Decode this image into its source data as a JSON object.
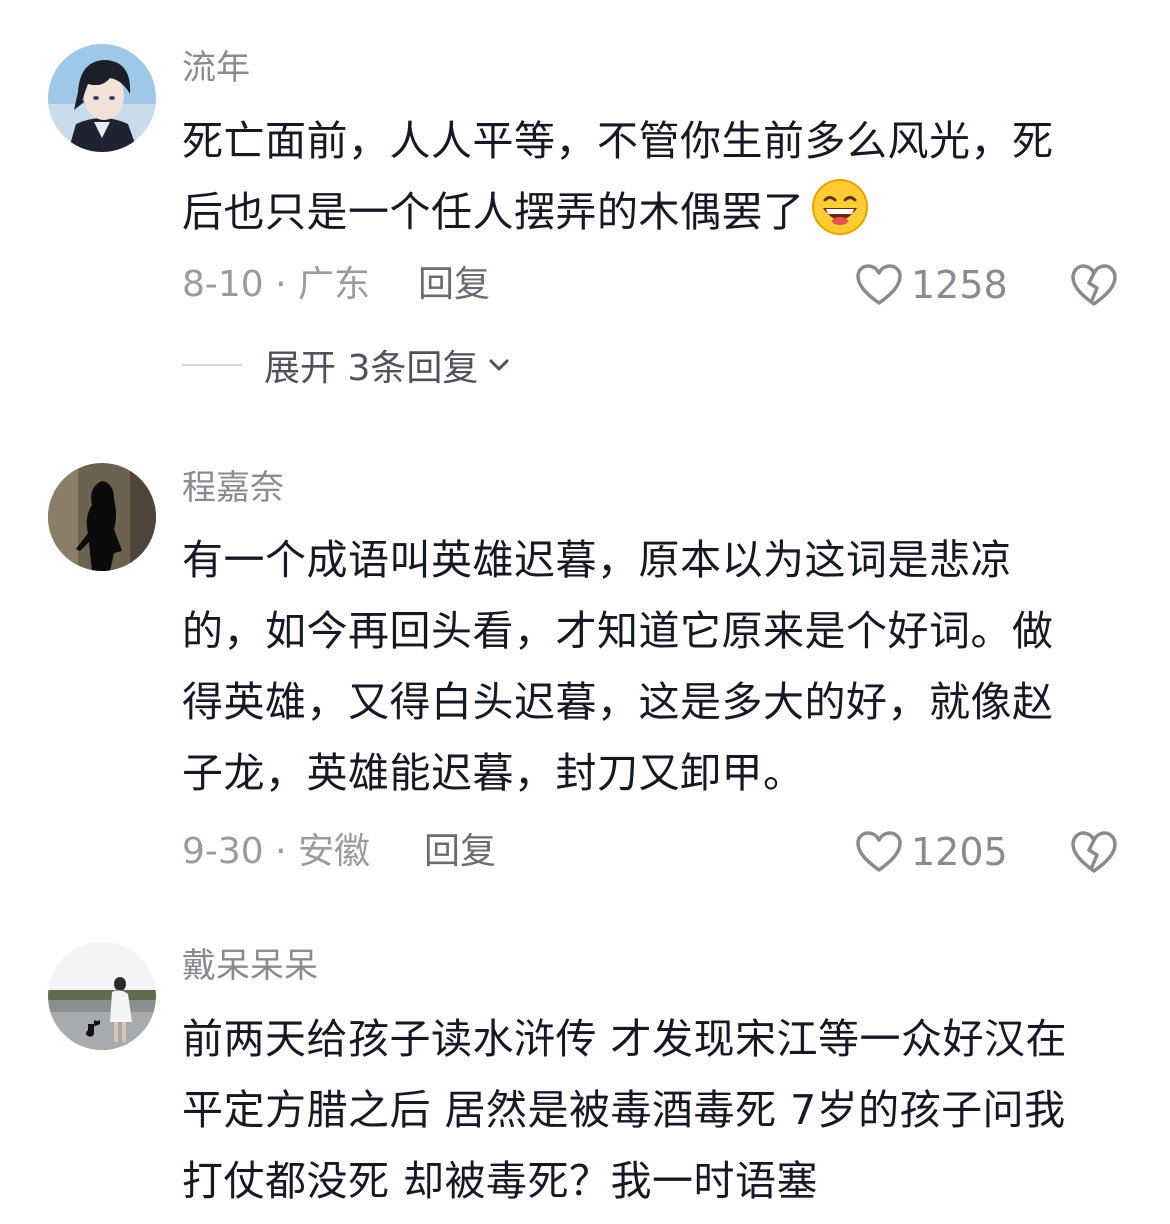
{
  "comments": [
    {
      "username": "流年",
      "lines": [
        "死亡面前，人人平等，不管你生前多么风光，死",
        "后也只是一个任人摆弄的木偶罢了"
      ],
      "emoji": "grinning-squint-emoji",
      "meta": "8-10 · 广东",
      "reply_label": "回复",
      "likes": "1258",
      "expand_label": "展开 3条回复"
    },
    {
      "username": "程嘉奈",
      "lines": [
        "有一个成语叫英雄迟暮，原本以为这词是悲凉",
        "的，如今再回头看，才知道它原来是个好词。做",
        "得英雄，又得白头迟暮，这是多大的好，就像赵",
        "子龙，英雄能迟暮，封刀又卸甲。"
      ],
      "meta": "9-30 · 安徽",
      "reply_label": "回复",
      "likes": "1205"
    },
    {
      "username": "戴呆呆呆",
      "lines": [
        "前两天给孩子读水浒传 才发现宋江等一众好汉在",
        "平定方腊之后 居然是被毒酒毒死 7岁的孩子问我",
        "打仗都没死 却被毒死？我一时语塞"
      ]
    }
  ],
  "colors": {
    "text": "#161823",
    "username": "#8a8b91",
    "meta": "#9a9ba1",
    "reply": "#6b6c72"
  },
  "icons": {
    "like": "heart-outline-icon",
    "dislike": "broken-heart-icon",
    "expand": "chevron-down-icon"
  }
}
